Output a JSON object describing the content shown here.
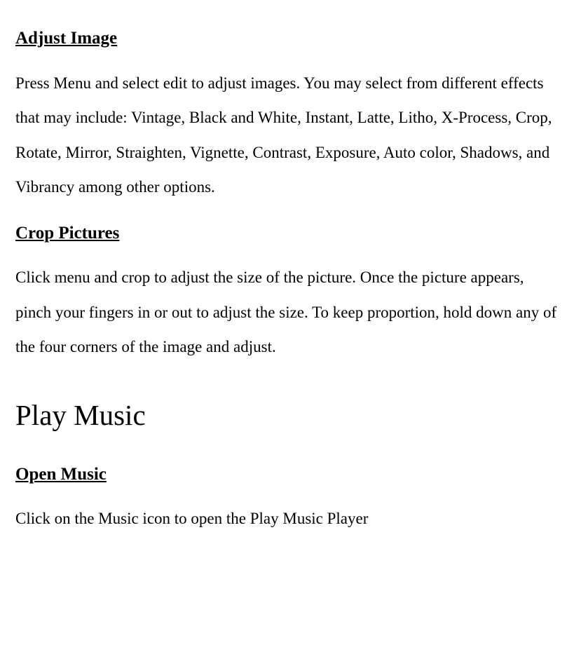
{
  "sections": {
    "adjustImage": {
      "heading": "Adjust Image",
      "body": "Press Menu and select edit to adjust images. You may select from different effects that may include: Vintage, Black and White, Instant, Latte, Litho, X-Process, Crop, Rotate, Mirror, Straighten, Vignette, Contrast, Exposure, Auto color, Shadows, and Vibrancy among other options."
    },
    "cropPictures": {
      "heading": "Crop Pictures",
      "body": "Click menu and crop to adjust the size of the picture. Once the picture appears, pinch your fingers in or out to adjust the size. To keep proportion, hold down any of the four corners of the image and adjust."
    },
    "playMusic": {
      "title": "Play Music",
      "openMusic": {
        "heading": "Open Music",
        "body": "Click on the Music icon to open the Play Music Player"
      }
    }
  }
}
